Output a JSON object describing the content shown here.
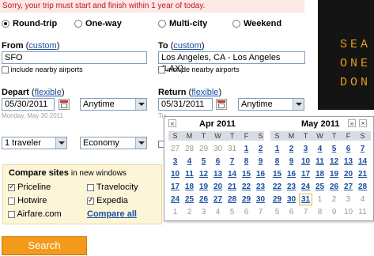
{
  "alert": "Sorry, your trip must start and finish within 1 year of today.",
  "trip_types": [
    {
      "label": "Round-trip",
      "selected": true
    },
    {
      "label": "One-way",
      "selected": false
    },
    {
      "label": "Multi-city",
      "selected": false
    },
    {
      "label": "Weekend",
      "selected": false
    }
  ],
  "from": {
    "label": "From",
    "custom_link": "custom",
    "value": "SFO",
    "nearby": "include nearby airports"
  },
  "to": {
    "label": "To",
    "custom_link": "custom",
    "value": "Los Angeles, CA - Los Angeles (LAX)",
    "nearby": "include nearby airports"
  },
  "depart": {
    "label": "Depart",
    "flexible_link": "flexible",
    "date": "05/30/2011",
    "time": "Anytime",
    "hint": "Monday, May 30 2011"
  },
  "return": {
    "label": "Return",
    "flexible_link": "flexible",
    "date": "05/31/2011",
    "time": "Anytime",
    "hint": "Tuesday, May 31 2011"
  },
  "travelers": "1 traveler",
  "cabin": "Economy",
  "compare": {
    "title": "Compare sites",
    "subtitle": "in new windows",
    "sites": [
      {
        "name": "Priceline",
        "checked": true
      },
      {
        "name": "Travelocity",
        "checked": false
      },
      {
        "name": "Hotwire",
        "checked": false
      },
      {
        "name": "Expedia",
        "checked": true
      },
      {
        "name": "Airfare.com",
        "checked": false
      }
    ],
    "compare_all": "Compare all"
  },
  "search_button": "Search",
  "board_letters": [
    "SEA",
    "ONE",
    "DON"
  ],
  "calendar": {
    "prev": "«",
    "next": "»",
    "close": "×",
    "weekdays": [
      "S",
      "M",
      "T",
      "W",
      "T",
      "F",
      "S"
    ],
    "months": [
      {
        "title": "Apr 2011",
        "weeks": [
          [
            "27",
            "28",
            "29",
            "30",
            "31",
            "1",
            "2"
          ],
          [
            "3",
            "4",
            "5",
            "6",
            "7",
            "8",
            "9"
          ],
          [
            "10",
            "11",
            "12",
            "13",
            "14",
            "15",
            "16"
          ],
          [
            "17",
            "18",
            "19",
            "20",
            "21",
            "22",
            "23"
          ],
          [
            "24",
            "25",
            "26",
            "27",
            "28",
            "29",
            "30"
          ],
          [
            "1",
            "2",
            "3",
            "4",
            "5",
            "6",
            "7"
          ]
        ]
      },
      {
        "title": "May 2011",
        "weeks": [
          [
            "1",
            "2",
            "3",
            "4",
            "5",
            "6",
            "7"
          ],
          [
            "8",
            "9",
            "10",
            "11",
            "12",
            "13",
            "14"
          ],
          [
            "15",
            "16",
            "17",
            "18",
            "19",
            "20",
            "21"
          ],
          [
            "22",
            "23",
            "24",
            "25",
            "26",
            "27",
            "28"
          ],
          [
            "29",
            "30",
            "31",
            "1",
            "2",
            "3",
            "4"
          ],
          [
            "5",
            "6",
            "7",
            "8",
            "9",
            "10",
            "11"
          ]
        ]
      }
    ],
    "selected": "31"
  }
}
